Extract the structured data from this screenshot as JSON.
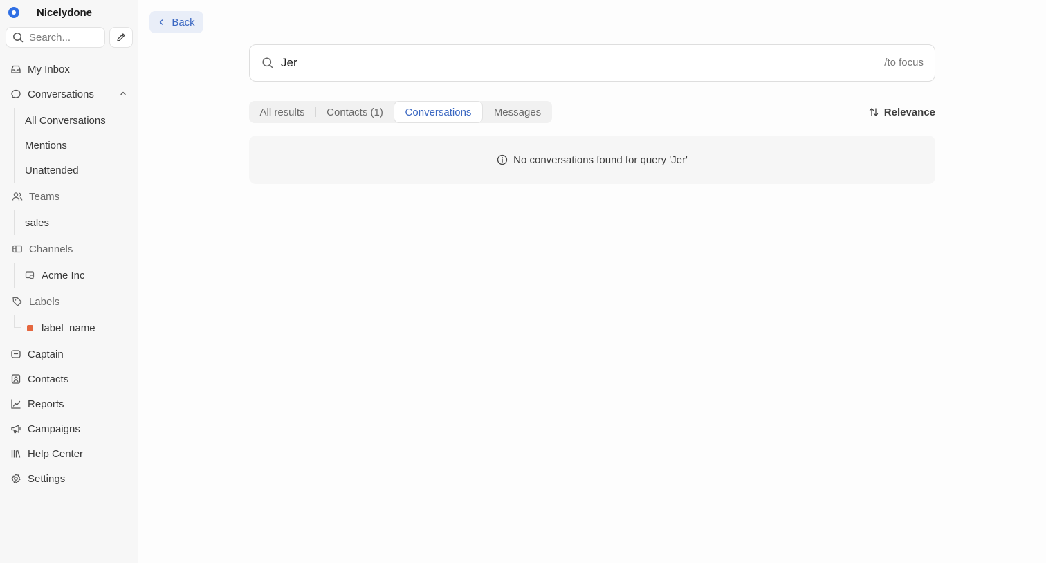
{
  "brand": {
    "name": "Nicelydone",
    "color": "#2f6fe4"
  },
  "sidebar": {
    "search_placeholder": "Search...",
    "items": [
      {
        "label": "My Inbox",
        "icon": "inbox-icon"
      },
      {
        "label": "Conversations",
        "icon": "chat-bubble-icon",
        "expanded": true,
        "children": [
          "All Conversations",
          "Mentions",
          "Unattended"
        ]
      },
      {
        "label": "Teams",
        "icon": "users-icon",
        "children": [
          "sales"
        ]
      },
      {
        "label": "Channels",
        "icon": "channel-icon",
        "children": [
          "Acme Inc"
        ]
      },
      {
        "label": "Labels",
        "icon": "tag-icon",
        "children": [
          {
            "label": "label_name",
            "color": "#e5673f"
          }
        ]
      },
      {
        "label": "Captain",
        "icon": "bot-icon"
      },
      {
        "label": "Contacts",
        "icon": "contact-card-icon"
      },
      {
        "label": "Reports",
        "icon": "chart-line-icon"
      },
      {
        "label": "Campaigns",
        "icon": "megaphone-icon"
      },
      {
        "label": "Help Center",
        "icon": "library-icon"
      },
      {
        "label": "Settings",
        "icon": "gear-icon"
      }
    ]
  },
  "header": {
    "back_label": "Back"
  },
  "search": {
    "query": "Jer",
    "shortcut_hint": "/to focus"
  },
  "tabs": [
    {
      "label": "All results",
      "active": false
    },
    {
      "label": "Contacts (1)",
      "active": false
    },
    {
      "label": "Conversations",
      "active": true
    },
    {
      "label": "Messages",
      "active": false
    }
  ],
  "sort": {
    "label": "Relevance"
  },
  "empty_state": {
    "message": "No conversations found for query 'Jer'"
  },
  "colors": {
    "accent": "#3b68c2",
    "label_dot": "#e5673f"
  }
}
